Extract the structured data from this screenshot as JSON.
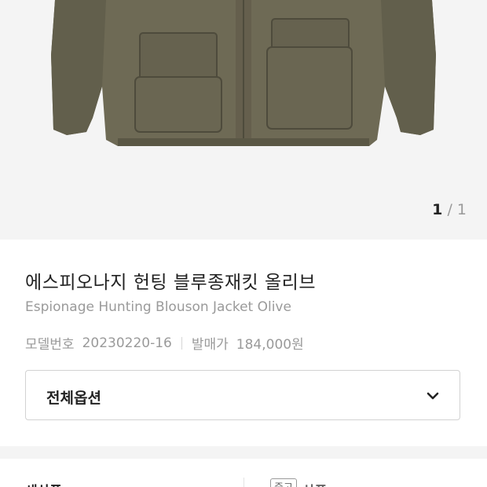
{
  "image": {
    "icon": "jacket-photo",
    "colors": {
      "background": "#f4f4f4",
      "jacket": "#6e6a55",
      "jacket_dark": "#5a5745"
    },
    "pager": {
      "current": "1",
      "separator": "/",
      "total": "1"
    }
  },
  "product": {
    "title": "에스피오나지 헌팅 블루종재킷 올리브",
    "subtitle": "Espionage Hunting Blouson Jacket Olive",
    "model_label": "모델번호",
    "model_value": "20230220-16",
    "price_label": "발매가",
    "price_value": "184,000원"
  },
  "options": {
    "label": "전체옵션",
    "icon": "chevron-down-icon"
  },
  "tabs": {
    "new_label": "새상품",
    "used_badge": "중고",
    "used_label": "상품"
  }
}
